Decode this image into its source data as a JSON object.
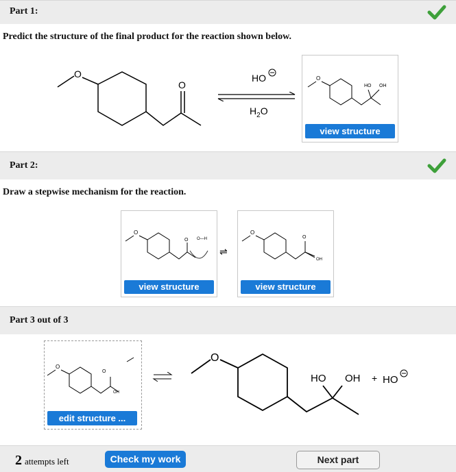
{
  "part1": {
    "title": "Part 1:",
    "prompt": "Predict the structure of the final product for the reaction shown below.",
    "reagent_top": "HO",
    "reagent_bottom_main": "H",
    "reagent_bottom_sub": "2",
    "reagent_bottom_end": "O",
    "view_button": "view structure",
    "product_labels": [
      "HO",
      "OH"
    ]
  },
  "part2": {
    "title": "Part 2:",
    "prompt": "Draw a stepwise mechanism for the reaction.",
    "view_button_1": "view structure",
    "view_button_2": "view structure",
    "eq_arrow": "⇌",
    "small_labels": {
      "o_h": "O—H",
      "oh": "OH"
    }
  },
  "part3": {
    "title": "Part 3 out of 3",
    "edit_button": "edit structure ...",
    "product_labels": [
      "HO",
      "OH"
    ],
    "plus": "+",
    "hydroxide": "HO",
    "small_oh": "OH"
  },
  "footer": {
    "attempts_count": "2",
    "attempts_text": "attempts left",
    "check_button": "Check my work",
    "next_button": "Next part"
  },
  "colors": {
    "accent": "#1a7ad7",
    "check_green": "#3ea03a",
    "bar_bg": "#ececec"
  }
}
